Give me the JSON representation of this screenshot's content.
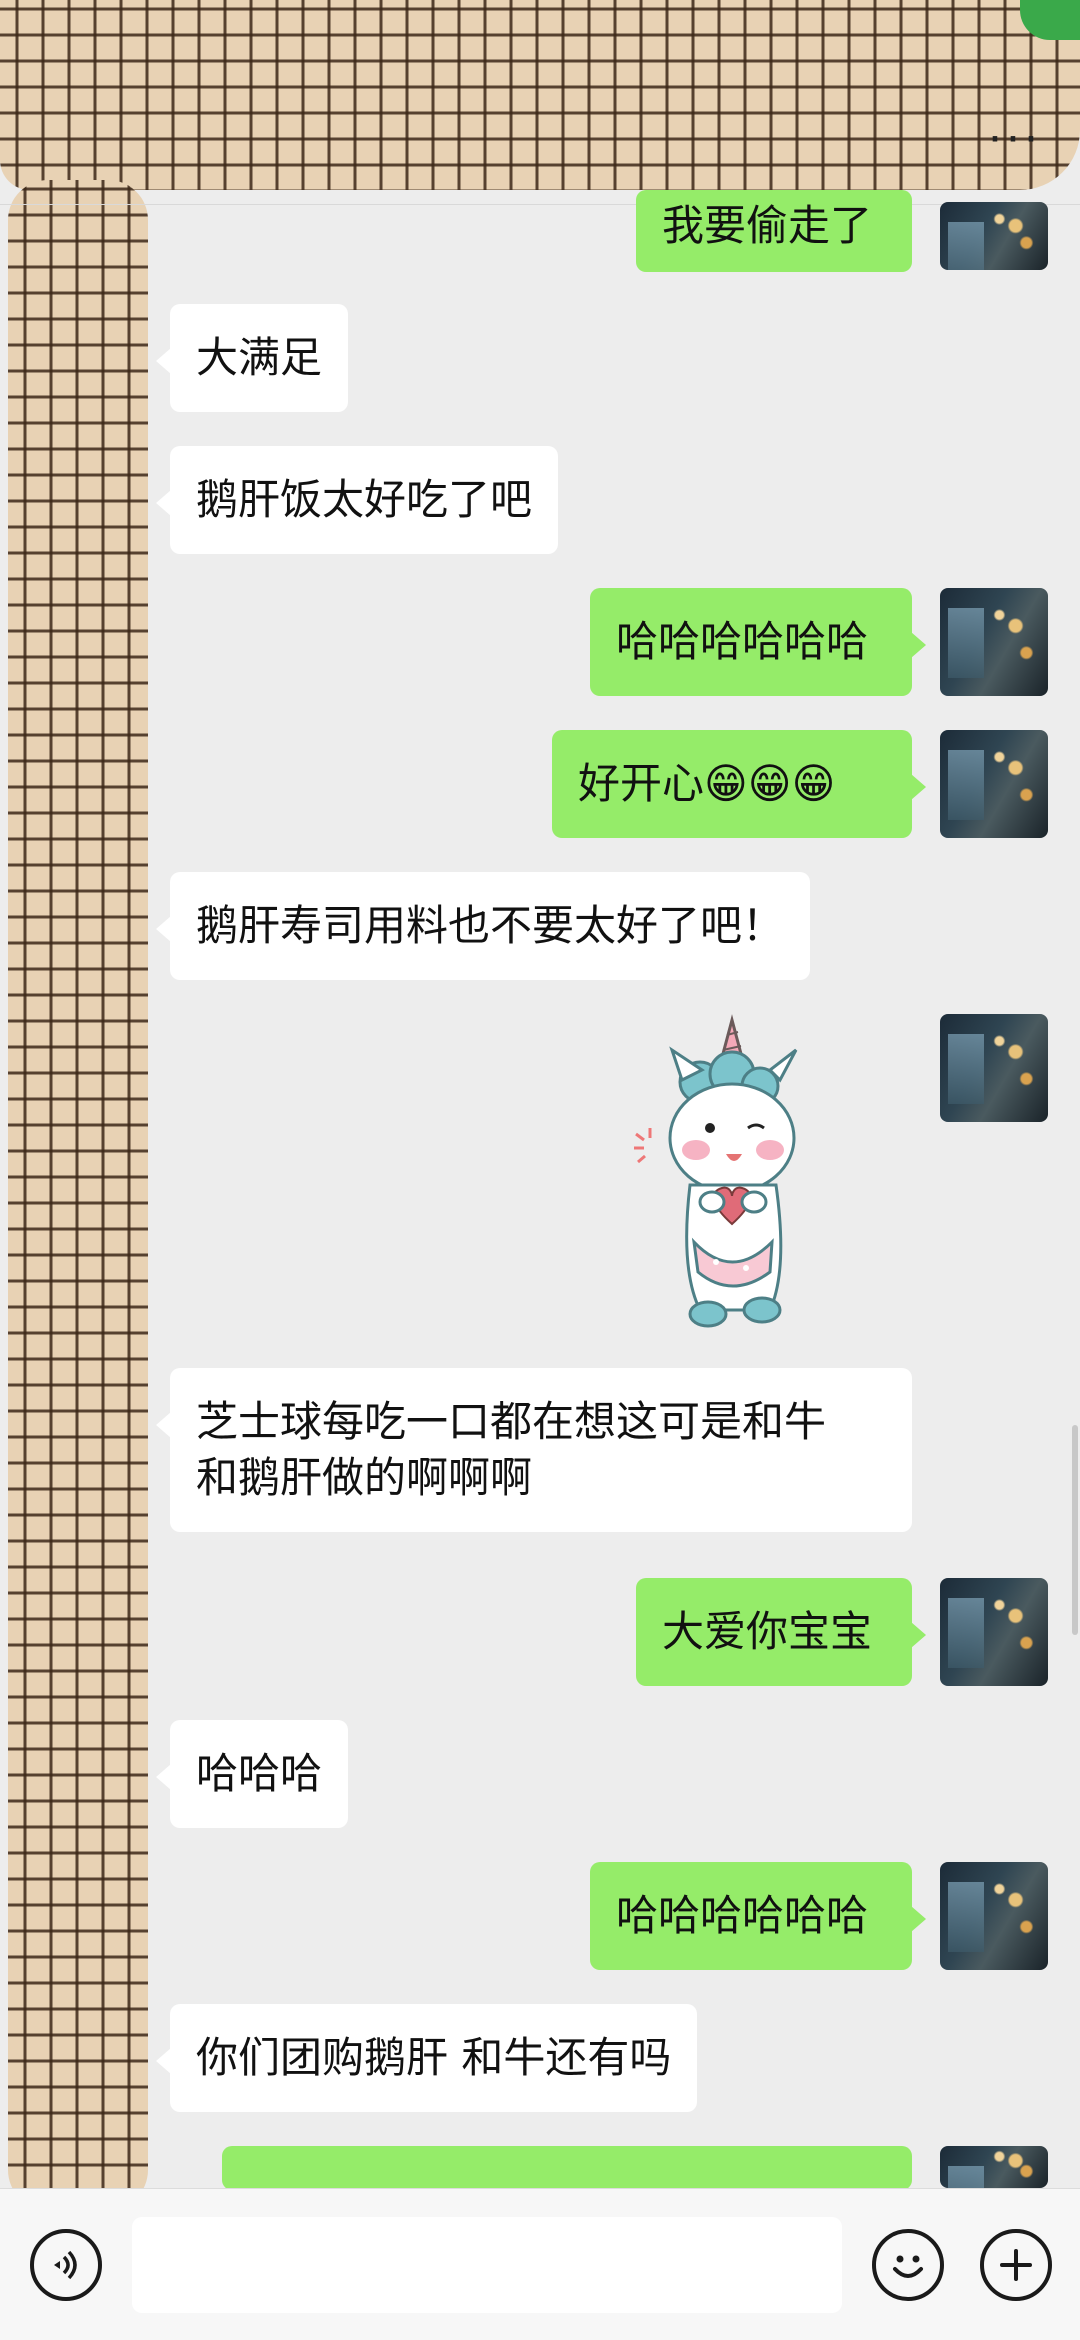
{
  "header": {
    "more_label": "···"
  },
  "messages": [
    {
      "side": "out",
      "text": "我要偷走了",
      "clipped": true
    },
    {
      "side": "in",
      "text": "大满足"
    },
    {
      "side": "in",
      "text": "鹅肝饭太好吃了吧"
    },
    {
      "side": "out",
      "text": "哈哈哈哈哈哈"
    },
    {
      "side": "out",
      "text": "好开心😁😁😁"
    },
    {
      "side": "in",
      "text": "鹅肝寿司用料也不要太好了吧！"
    },
    {
      "side": "out",
      "type": "sticker",
      "sticker": "unicorn-heart-sticker"
    },
    {
      "side": "in",
      "text": "芝士球每吃一口都在想这可是和牛\n和鹅肝做的啊啊啊"
    },
    {
      "side": "out",
      "text": "大爱你宝宝"
    },
    {
      "side": "in",
      "text": "哈哈哈"
    },
    {
      "side": "out",
      "text": "哈哈哈哈哈哈"
    },
    {
      "side": "in",
      "text": "你们团购鹅肝 和牛还有吗"
    }
  ],
  "colors": {
    "background": "#ededed",
    "incoming_bubble": "#ffffff",
    "outgoing_bubble": "#95ec69"
  },
  "input_bar": {
    "voice_icon": "voice-icon",
    "emoji_icon": "smiley-icon",
    "plus_icon": "plus-icon",
    "value": ""
  }
}
